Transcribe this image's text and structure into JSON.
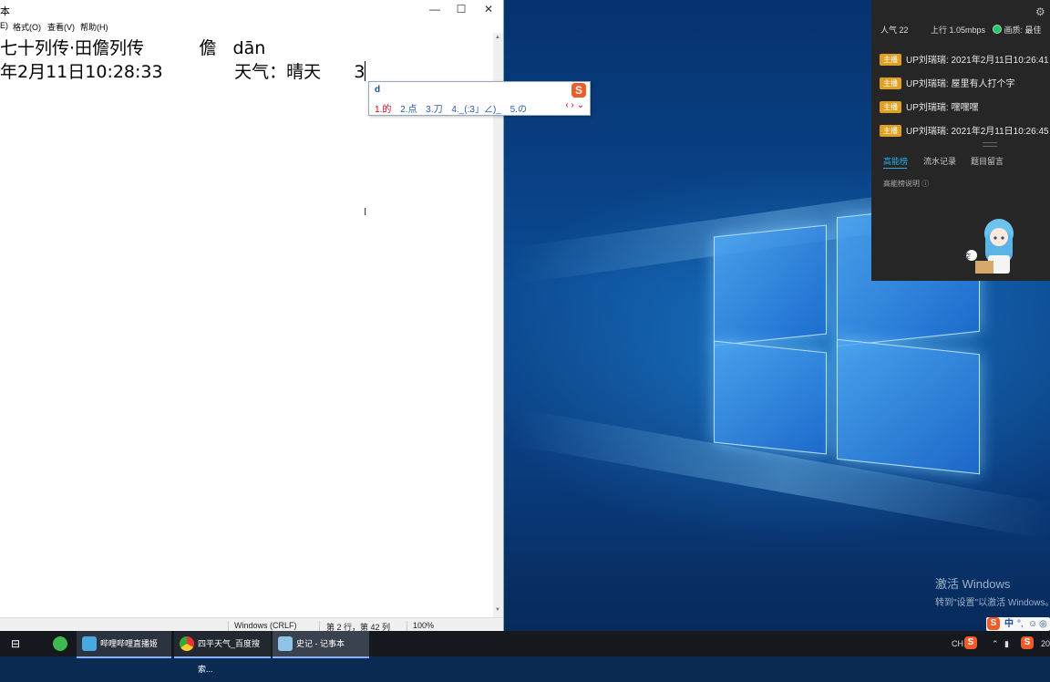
{
  "notepad": {
    "title_fragment": "本",
    "menu": [
      "E)",
      "格式(O)",
      "查看(V)",
      "帮助(H)"
    ],
    "lines": [
      "七十列传·田儋列传          儋   dān",
      "年2月11日10:28:33             天气：晴天      3"
    ],
    "status": {
      "eol": "Windows (CRLF)",
      "position": "第 2 行，第 42 列",
      "zoom": "100%"
    }
  },
  "ime": {
    "composition": "d",
    "candidates": [
      "1.的",
      "2.点",
      "3.刀",
      "4._(:3」∠)_",
      "5.の"
    ],
    "nav": "‹ › ⌄"
  },
  "live_panel": {
    "popularity": "人气 22",
    "upload": "上行 1.05mbps",
    "quality": "画质: 最佳",
    "messages": [
      {
        "badge": "主播",
        "text": "UP刘瑞瑞: 2021年2月11日10:26:41"
      },
      {
        "badge": "主播",
        "text": "UP刘瑞瑞: 屋里有人打个字"
      },
      {
        "badge": "主播",
        "text": "UP刘瑞瑞: 嘿嘿嘿"
      },
      {
        "badge": "主播",
        "text": "UP刘瑞瑞: 2021年2月11日10:26:45"
      }
    ],
    "tabs": [
      "高能榜",
      "流水记录",
      "题目留言"
    ],
    "rank_note": "高能榜说明",
    "mascot_bubble": "空"
  },
  "desktop": {
    "activate_title": "激活 Windows",
    "activate_sub": "转到\"设置\"以激活 Windows。"
  },
  "taskbar": {
    "items": [
      {
        "label": "哔哩哔哩直播姬"
      },
      {
        "label": "四平天气_百度搜索..."
      },
      {
        "label": "史记 - 记事本"
      }
    ],
    "tray": {
      "ime_lang": "中",
      "lang": "CH",
      "clock_fragment": "20"
    }
  },
  "colors": {
    "accent_blue": "#23ade5",
    "badge": "#e0a020",
    "sogou": "#ef5b2b"
  }
}
